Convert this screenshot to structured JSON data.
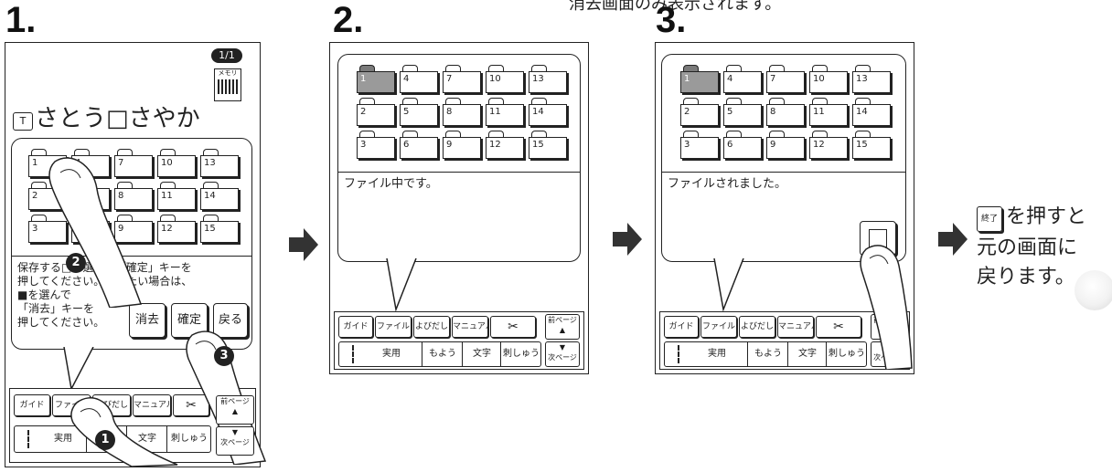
{
  "header_partial_text": "消去画面のみ表示されます。",
  "steps": [
    {
      "number": "1.",
      "page_badge": "1/1",
      "memo_label": "メモリ",
      "name_prefix": "T",
      "name_text": "さとう□さやか",
      "folders": [
        "1",
        "4",
        "7",
        "10",
        "13",
        "2",
        "5",
        "8",
        "11",
        "14",
        "3",
        "6",
        "9",
        "12",
        "15"
      ],
      "message": "保存する□を選んで「確定」キーを\n押してください。消したい場合は、\n■を選んで\n「消去」キーを\n押してください。",
      "buttons": {
        "erase": "消去",
        "confirm": "確定",
        "back": "戻る"
      },
      "callouts": [
        "1",
        "2",
        "3"
      ]
    },
    {
      "number": "2.",
      "folders": [
        "1",
        "4",
        "7",
        "10",
        "13",
        "2",
        "5",
        "8",
        "11",
        "14",
        "3",
        "6",
        "9",
        "12",
        "15"
      ],
      "message": "ファイル中です。"
    },
    {
      "number": "3.",
      "folders": [
        "1",
        "4",
        "7",
        "10",
        "13",
        "2",
        "5",
        "8",
        "11",
        "14",
        "3",
        "6",
        "9",
        "12",
        "15"
      ],
      "message": "ファイルされました。"
    }
  ],
  "toolbar": {
    "top": [
      "ガイド",
      "ファイル",
      "よびだし",
      "マニュアル",
      "✂"
    ],
    "bottom": [
      "実用",
      "もよう",
      "文字",
      "刺しゅう"
    ],
    "prev_page": "前ページ",
    "next_page": "次ページ"
  },
  "result": {
    "end_key": "終了",
    "line1": "を押すと",
    "line2": "元の画面に",
    "line3": "戻ります。"
  }
}
